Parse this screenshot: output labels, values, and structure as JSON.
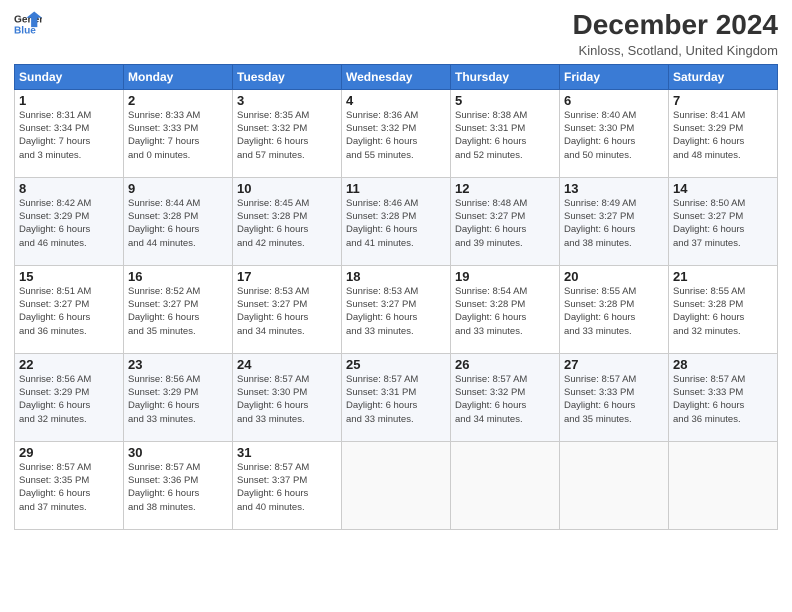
{
  "logo": {
    "line1": "General",
    "line2": "Blue"
  },
  "title": "December 2024",
  "subtitle": "Kinloss, Scotland, United Kingdom",
  "headers": [
    "Sunday",
    "Monday",
    "Tuesday",
    "Wednesday",
    "Thursday",
    "Friday",
    "Saturday"
  ],
  "weeks": [
    [
      {
        "day": "1",
        "sunrise": "8:31 AM",
        "sunset": "3:34 PM",
        "daylight": "7 hours and 3 minutes."
      },
      {
        "day": "2",
        "sunrise": "8:33 AM",
        "sunset": "3:33 PM",
        "daylight": "7 hours and 0 minutes."
      },
      {
        "day": "3",
        "sunrise": "8:35 AM",
        "sunset": "3:32 PM",
        "daylight": "6 hours and 57 minutes."
      },
      {
        "day": "4",
        "sunrise": "8:36 AM",
        "sunset": "3:32 PM",
        "daylight": "6 hours and 55 minutes."
      },
      {
        "day": "5",
        "sunrise": "8:38 AM",
        "sunset": "3:31 PM",
        "daylight": "6 hours and 52 minutes."
      },
      {
        "day": "6",
        "sunrise": "8:40 AM",
        "sunset": "3:30 PM",
        "daylight": "6 hours and 50 minutes."
      },
      {
        "day": "7",
        "sunrise": "8:41 AM",
        "sunset": "3:29 PM",
        "daylight": "6 hours and 48 minutes."
      }
    ],
    [
      {
        "day": "8",
        "sunrise": "8:42 AM",
        "sunset": "3:29 PM",
        "daylight": "6 hours and 46 minutes."
      },
      {
        "day": "9",
        "sunrise": "8:44 AM",
        "sunset": "3:28 PM",
        "daylight": "6 hours and 44 minutes."
      },
      {
        "day": "10",
        "sunrise": "8:45 AM",
        "sunset": "3:28 PM",
        "daylight": "6 hours and 42 minutes."
      },
      {
        "day": "11",
        "sunrise": "8:46 AM",
        "sunset": "3:28 PM",
        "daylight": "6 hours and 41 minutes."
      },
      {
        "day": "12",
        "sunrise": "8:48 AM",
        "sunset": "3:27 PM",
        "daylight": "6 hours and 39 minutes."
      },
      {
        "day": "13",
        "sunrise": "8:49 AM",
        "sunset": "3:27 PM",
        "daylight": "6 hours and 38 minutes."
      },
      {
        "day": "14",
        "sunrise": "8:50 AM",
        "sunset": "3:27 PM",
        "daylight": "6 hours and 37 minutes."
      }
    ],
    [
      {
        "day": "15",
        "sunrise": "8:51 AM",
        "sunset": "3:27 PM",
        "daylight": "6 hours and 36 minutes."
      },
      {
        "day": "16",
        "sunrise": "8:52 AM",
        "sunset": "3:27 PM",
        "daylight": "6 hours and 35 minutes."
      },
      {
        "day": "17",
        "sunrise": "8:53 AM",
        "sunset": "3:27 PM",
        "daylight": "6 hours and 34 minutes."
      },
      {
        "day": "18",
        "sunrise": "8:53 AM",
        "sunset": "3:27 PM",
        "daylight": "6 hours and 33 minutes."
      },
      {
        "day": "19",
        "sunrise": "8:54 AM",
        "sunset": "3:28 PM",
        "daylight": "6 hours and 33 minutes."
      },
      {
        "day": "20",
        "sunrise": "8:55 AM",
        "sunset": "3:28 PM",
        "daylight": "6 hours and 33 minutes."
      },
      {
        "day": "21",
        "sunrise": "8:55 AM",
        "sunset": "3:28 PM",
        "daylight": "6 hours and 32 minutes."
      }
    ],
    [
      {
        "day": "22",
        "sunrise": "8:56 AM",
        "sunset": "3:29 PM",
        "daylight": "6 hours and 32 minutes."
      },
      {
        "day": "23",
        "sunrise": "8:56 AM",
        "sunset": "3:29 PM",
        "daylight": "6 hours and 33 minutes."
      },
      {
        "day": "24",
        "sunrise": "8:57 AM",
        "sunset": "3:30 PM",
        "daylight": "6 hours and 33 minutes."
      },
      {
        "day": "25",
        "sunrise": "8:57 AM",
        "sunset": "3:31 PM",
        "daylight": "6 hours and 33 minutes."
      },
      {
        "day": "26",
        "sunrise": "8:57 AM",
        "sunset": "3:32 PM",
        "daylight": "6 hours and 34 minutes."
      },
      {
        "day": "27",
        "sunrise": "8:57 AM",
        "sunset": "3:33 PM",
        "daylight": "6 hours and 35 minutes."
      },
      {
        "day": "28",
        "sunrise": "8:57 AM",
        "sunset": "3:33 PM",
        "daylight": "6 hours and 36 minutes."
      }
    ],
    [
      {
        "day": "29",
        "sunrise": "8:57 AM",
        "sunset": "3:35 PM",
        "daylight": "6 hours and 37 minutes."
      },
      {
        "day": "30",
        "sunrise": "8:57 AM",
        "sunset": "3:36 PM",
        "daylight": "6 hours and 38 minutes."
      },
      {
        "day": "31",
        "sunrise": "8:57 AM",
        "sunset": "3:37 PM",
        "daylight": "6 hours and 40 minutes."
      },
      null,
      null,
      null,
      null
    ]
  ]
}
